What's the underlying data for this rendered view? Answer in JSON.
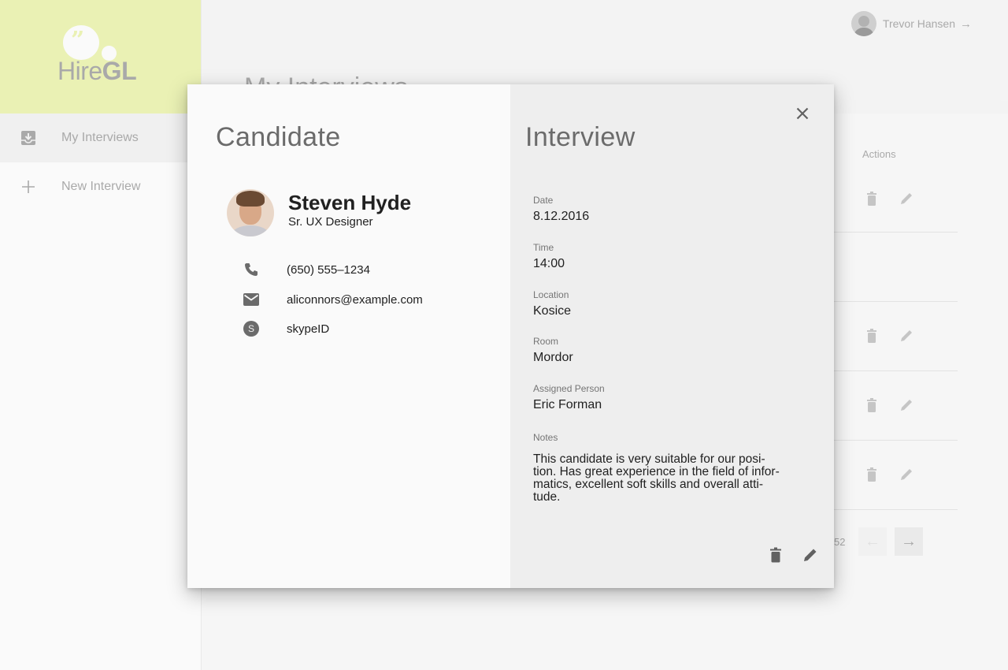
{
  "brand": {
    "name_light": "Hire",
    "name_bold": "GL",
    "logo_quote": "”"
  },
  "sidebar": {
    "items": [
      {
        "label": "My Interviews",
        "icon": "inbox-icon",
        "active": true
      },
      {
        "label": "New Interview",
        "icon": "plus-icon",
        "active": false
      }
    ]
  },
  "header": {
    "user_name": "Trevor Hansen",
    "page_title": "My Interviews"
  },
  "table": {
    "actions_header": "Actions",
    "pagination_text": "52"
  },
  "modal": {
    "candidate": {
      "section_title": "Candidate",
      "name": "Steven Hyde",
      "role": "Sr. UX Designer",
      "phone": "(650) 555–1234",
      "email": "aliconnors@example.com",
      "skype_badge": "S",
      "skype": "skypeID"
    },
    "interview": {
      "section_title": "Interview",
      "date_label": "Date",
      "date": "8.12.2016",
      "time_label": "Time",
      "time": "14:00",
      "location_label": "Location",
      "location": "Kosice",
      "room_label": "Room",
      "room": "Mordor",
      "assigned_label": "Assigned Person",
      "assigned": "Eric Forman",
      "notes_label": "Notes",
      "notes_lines": [
        "This candidate is very suitable for our posi-",
        "tion. Has great experience in the field of infor-",
        "matics, excellent soft skills and overall atti-",
        "tude."
      ]
    }
  },
  "colors": {
    "logo_bg": "#e7f0aa",
    "right_panel": "#eeeeee",
    "left_panel": "#fafafa"
  }
}
